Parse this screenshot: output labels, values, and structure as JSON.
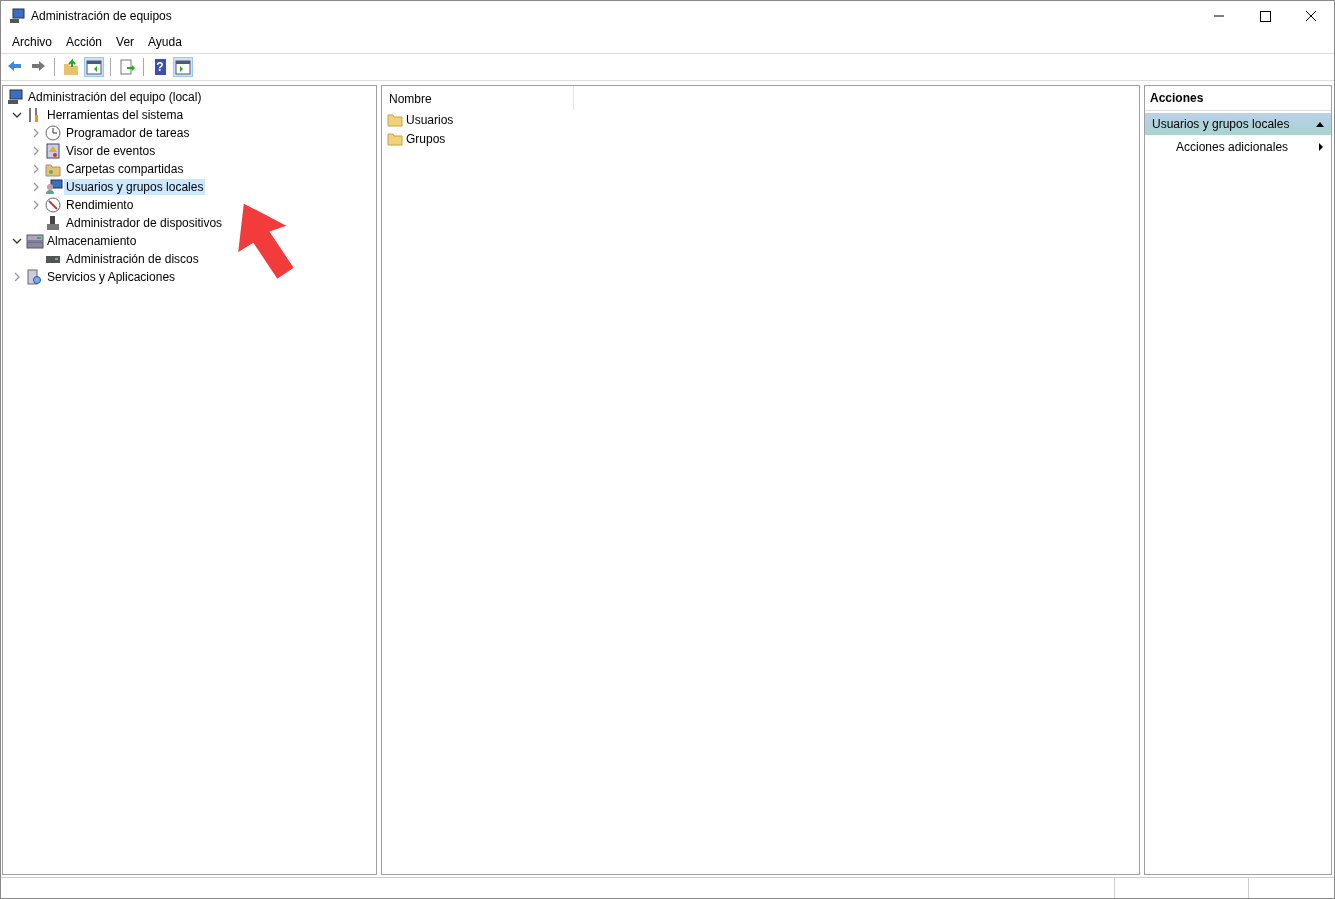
{
  "window": {
    "title": "Administración de equipos"
  },
  "menu": [
    "Archivo",
    "Acción",
    "Ver",
    "Ayuda"
  ],
  "toolbar": [
    {
      "kind": "back",
      "pressed": false
    },
    {
      "kind": "forward",
      "pressed": false
    },
    {
      "kind": "sep"
    },
    {
      "kind": "up",
      "pressed": false
    },
    {
      "kind": "tree",
      "pressed": true
    },
    {
      "kind": "sep"
    },
    {
      "kind": "export",
      "pressed": false
    },
    {
      "kind": "sep"
    },
    {
      "kind": "help",
      "pressed": false,
      "label": "?"
    },
    {
      "kind": "actionpane",
      "pressed": true
    }
  ],
  "tree": [
    {
      "label": "Administración del equipo (local)",
      "kind": "computer",
      "selected": false,
      "children": [
        {
          "label": "Herramientas del sistema",
          "kind": "tools",
          "expanded": true,
          "selected": false,
          "children": [
            {
              "label": "Programador de tareas",
              "kind": "clock",
              "expanded": false,
              "selected": false
            },
            {
              "label": "Visor de eventos",
              "kind": "event",
              "expanded": false,
              "selected": false
            },
            {
              "label": "Carpetas compartidas",
              "kind": "share",
              "expanded": false,
              "selected": false
            },
            {
              "label": "Usuarios y grupos locales",
              "kind": "users",
              "expanded": false,
              "selected": true
            },
            {
              "label": "Rendimiento",
              "kind": "perf",
              "expanded": false,
              "selected": false
            },
            {
              "label": "Administrador de dispositivos",
              "kind": "device",
              "selected": false
            }
          ]
        },
        {
          "label": "Almacenamiento",
          "kind": "storage",
          "expanded": true,
          "selected": false,
          "children": [
            {
              "label": "Administración de discos",
              "kind": "disk",
              "selected": false
            }
          ]
        },
        {
          "label": "Servicios y Aplicaciones",
          "kind": "services",
          "expanded": false,
          "selected": false
        }
      ]
    }
  ],
  "list": {
    "columns": [
      "Nombre"
    ],
    "rows": [
      "Usuarios",
      "Grupos"
    ]
  },
  "actions": {
    "title": "Acciones",
    "section": "Usuarios y grupos locales",
    "items": [
      "Acciones adicionales"
    ]
  }
}
